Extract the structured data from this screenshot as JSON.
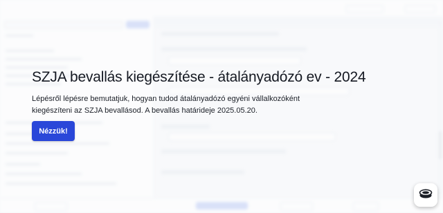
{
  "promo": {
    "title": "SZJA bevallás kiegészítése - átalányadózó ev - 2024",
    "description": "Lépésről lépésre bemutatjuk, hogyan tudod átalányadózó egyéni vállalkozóként kiegészíteni az SZJA bevallásod. A bevallás határideje 2025.05.20.",
    "cta_label": "Nézzük!"
  },
  "colors": {
    "accent": "#2a47d9",
    "background": "#f4f6f9",
    "widget": "#ffffff"
  },
  "icons": {
    "chat_widget": "chat-bubble-icon"
  }
}
